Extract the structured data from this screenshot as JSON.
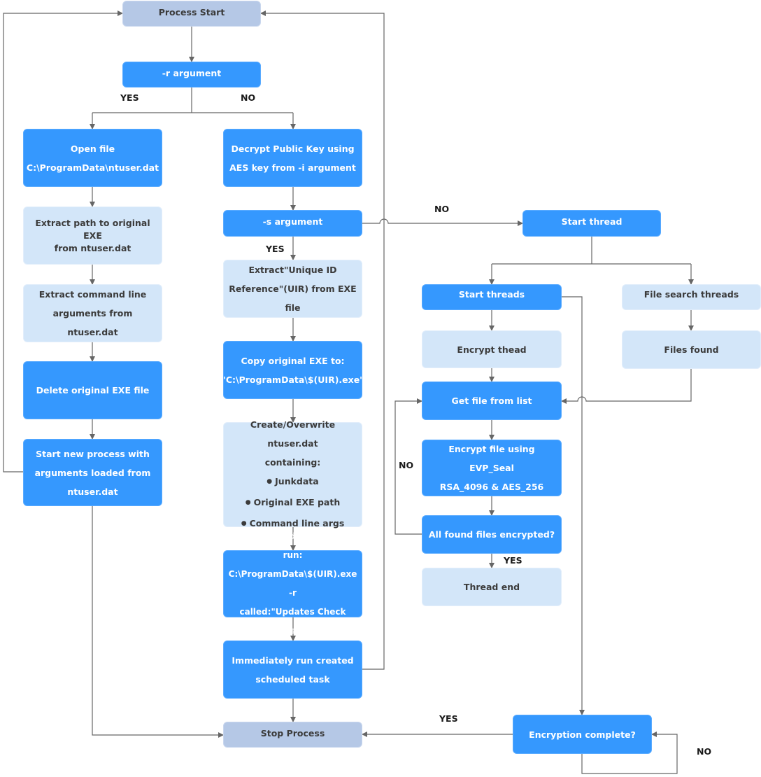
{
  "diagram": {
    "type": "flowchart",
    "nodes": {
      "process_start": "Process Start",
      "r_argument": "-r argument",
      "open_file": [
        "Open file",
        "C:\\ProgramData\\ntuser.dat"
      ],
      "extract_path": [
        "Extract path to original EXE",
        "from ntuser.dat"
      ],
      "extract_cmd": [
        "Extract command line",
        "arguments from ntuser.dat"
      ],
      "delete_exe": "Delete original EXE file",
      "start_new_process": [
        "Start new process with",
        "arguments loaded from",
        "ntuser.dat"
      ],
      "decrypt_key": [
        "Decrypt Public Key using",
        "AES key from -i argument"
      ],
      "s_argument": "-s argument",
      "extract_uir": [
        "Extract\"Unique ID",
        "Reference\"(UIR) from EXE file"
      ],
      "copy_exe": [
        "Copy original EXE to:",
        "\"C:\\ProgramData\\$(UIR).exe\""
      ],
      "create_ntuser": {
        "lines": [
          "Create/Overwrite ntuser.dat",
          "containing:"
        ],
        "bullets": [
          "Junkdata",
          "Original EXE path",
          "Command line args"
        ]
      },
      "create_task": [
        "Create scheduled task to run:",
        "C:\\ProgramData\\$(UIR).exe -r",
        "called:\"Updates Check Task\""
      ],
      "run_task": [
        "Immediately run created",
        "scheduled task"
      ],
      "stop_process": "Stop Process",
      "start_thread": "Start thread",
      "start_threads": "Start threads",
      "file_search_threads": "File search threads",
      "encrypt_thead": "Encrypt thead",
      "files_found": "Files found",
      "get_file": "Get file from list",
      "encrypt_file": [
        "Encrypt file using EVP_Seal",
        "RSA_4096 & AES_256"
      ],
      "all_encrypted": "All found files encrypted?",
      "thread_end": "Thread end",
      "encryption_complete": "Encryption complete?"
    },
    "edge_labels": {
      "r_yes": "YES",
      "r_no": "NO",
      "s_yes": "YES",
      "s_no": "NO",
      "all_no": "NO",
      "all_yes": "YES",
      "complete_yes": "YES",
      "complete_no": "NO"
    },
    "colors": {
      "process_box": "#3598fe",
      "data_box": "#d3e6f9",
      "terminal_box": "#b5c8e6",
      "connector": "#666666"
    }
  }
}
